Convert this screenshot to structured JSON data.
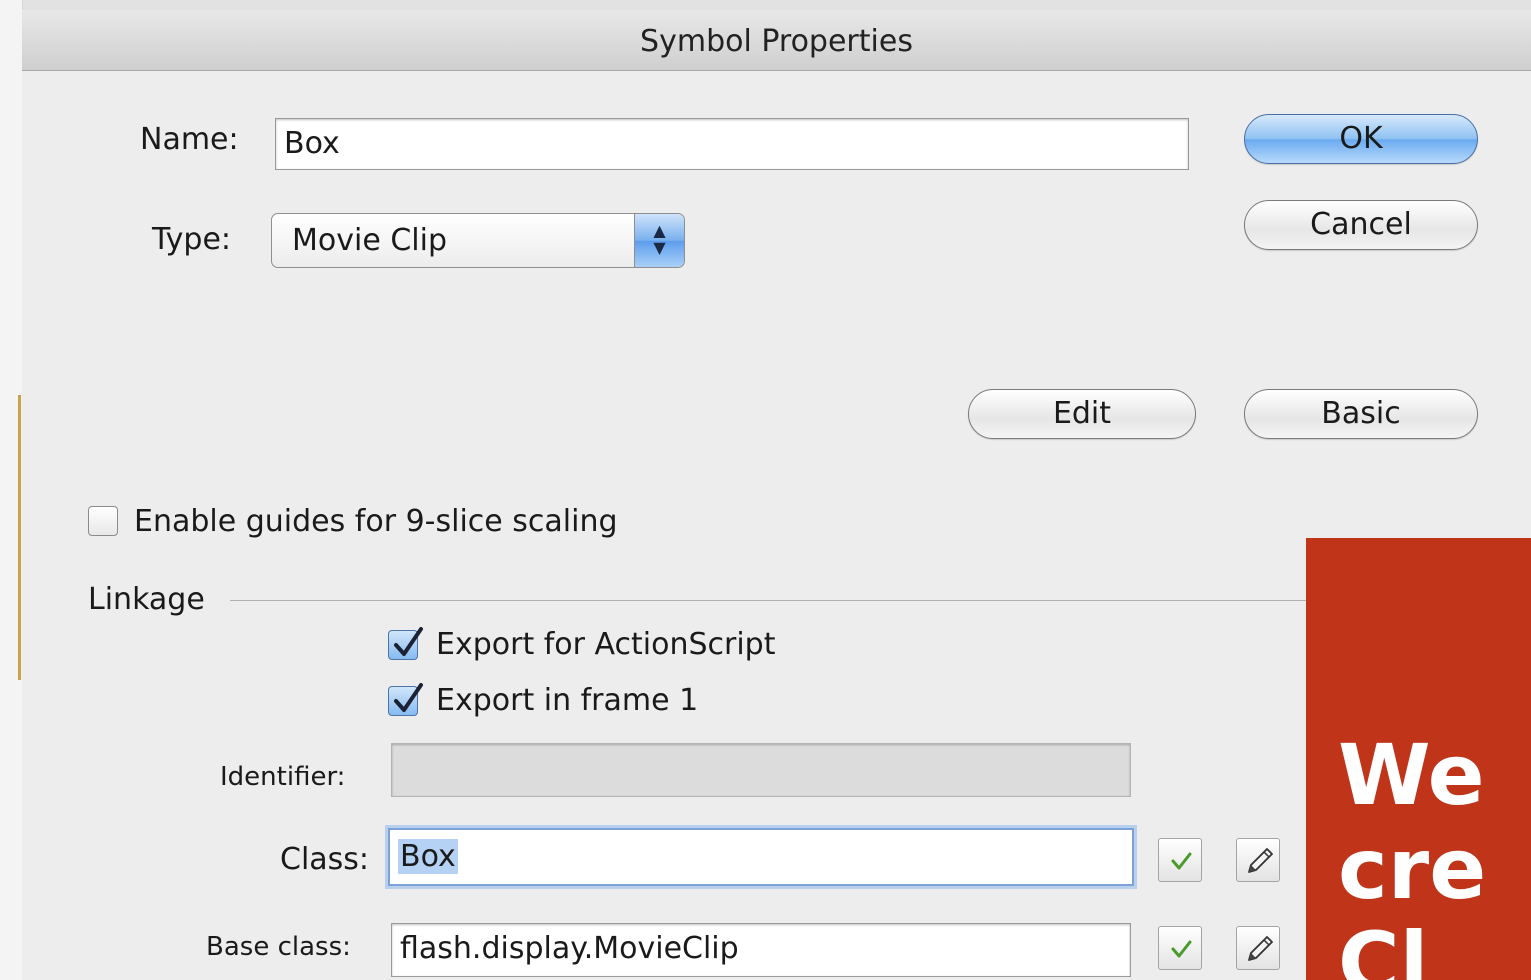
{
  "dialog": {
    "title": "Symbol Properties",
    "name_label": "Name:",
    "name_value": "Box",
    "type_label": "Type:",
    "type_value": "Movie Clip",
    "ok_label": "OK",
    "cancel_label": "Cancel",
    "edit_label": "Edit",
    "basic_label": "Basic",
    "nine_slice": {
      "label": "Enable guides for 9-slice scaling",
      "checked": false
    },
    "linkage": {
      "label": "Linkage",
      "export_actionscript": {
        "label": "Export for ActionScript",
        "checked": true
      },
      "export_frame1": {
        "label": "Export in frame 1",
        "checked": true
      },
      "identifier_label": "Identifier:",
      "identifier_value": "",
      "class_label": "Class:",
      "class_value": "Box",
      "base_class_label": "Base class:",
      "base_class_value": "flash.display.MovieClip"
    }
  },
  "overlay": {
    "text": "We\ncre\nCl",
    "color": "#c0341a"
  },
  "icons": {
    "validate": "check-icon",
    "edit": "pencil-icon",
    "stepper": "up-down-arrows-icon"
  }
}
